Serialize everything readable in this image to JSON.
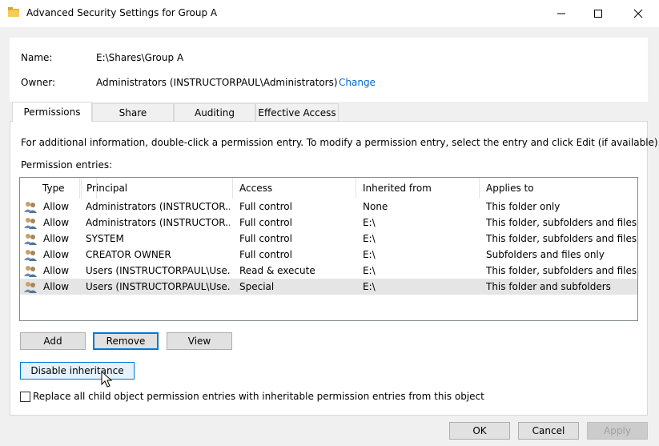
{
  "window": {
    "title": "Advanced Security Settings for Group A"
  },
  "info": {
    "name_label": "Name:",
    "name_value": "E:\\Shares\\Group A",
    "owner_label": "Owner:",
    "owner_value": "Administrators (INSTRUCTORPAUL\\Administrators)",
    "change_link": "Change"
  },
  "tabs": [
    {
      "label": "Permissions",
      "active": true
    },
    {
      "label": "Share"
    },
    {
      "label": "Auditing"
    },
    {
      "label": "Effective Access"
    }
  ],
  "permissions": {
    "info_text": "For additional information, double-click a permission entry. To modify a permission entry, select the entry and click Edit (if available).",
    "entries_label": "Permission entries:",
    "columns": [
      "Type",
      "Principal",
      "Access",
      "Inherited from",
      "Applies to"
    ],
    "rows": [
      {
        "type": "Allow",
        "principal": "Administrators (INSTRUCTOR...",
        "access": "Full control",
        "inherited_from": "None",
        "applies_to": "This folder only"
      },
      {
        "type": "Allow",
        "principal": "Administrators (INSTRUCTOR...",
        "access": "Full control",
        "inherited_from": "E:\\",
        "applies_to": "This folder, subfolders and files"
      },
      {
        "type": "Allow",
        "principal": "SYSTEM",
        "access": "Full control",
        "inherited_from": "E:\\",
        "applies_to": "This folder, subfolders and files"
      },
      {
        "type": "Allow",
        "principal": "CREATOR OWNER",
        "access": "Full control",
        "inherited_from": "E:\\",
        "applies_to": "Subfolders and files only"
      },
      {
        "type": "Allow",
        "principal": "Users (INSTRUCTORPAUL\\Use...",
        "access": "Read & execute",
        "inherited_from": "E:\\",
        "applies_to": "This folder, subfolders and files"
      },
      {
        "type": "Allow",
        "principal": "Users (INSTRUCTORPAUL\\Use...",
        "access": "Special",
        "inherited_from": "E:\\",
        "applies_to": "This folder and subfolders"
      }
    ],
    "add_label": "Add",
    "remove_label": "Remove",
    "view_label": "View",
    "disable_inheritance_label": "Disable inheritance",
    "replace_checkbox_label": "Replace all child object permission entries with inheritable permission entries from this object",
    "replace_checked": false
  },
  "footer": {
    "ok_label": "OK",
    "cancel_label": "Cancel",
    "apply_label": "Apply"
  },
  "colors": {
    "link": "#0066cc",
    "focus_border": "#0078d7",
    "selected_row": "#e5e5e5"
  },
  "icons": {
    "title": "folder-icon",
    "row": "users-icon",
    "cursor": "mouse-pointer-icon"
  }
}
